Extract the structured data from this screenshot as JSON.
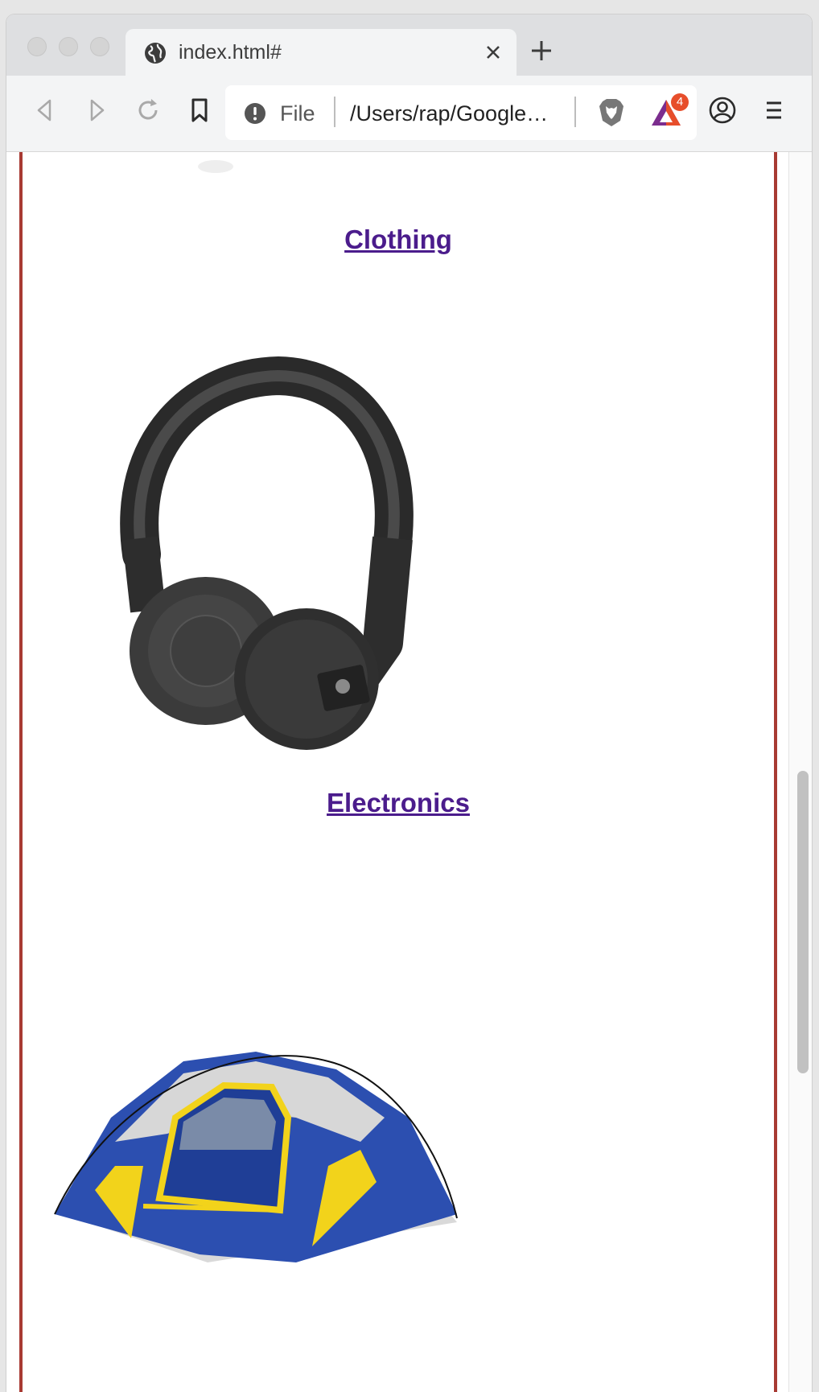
{
  "browser": {
    "tab": {
      "title": "index.html#"
    },
    "url": {
      "scheme": "File",
      "path": "/Users/rap/Google…"
    },
    "rewards_badge": "4"
  },
  "page": {
    "categories": [
      {
        "label": "Clothing",
        "image_icon": "headphones-image"
      },
      {
        "label": "Electronics",
        "image_icon": "tent-image"
      }
    ]
  },
  "colors": {
    "frame_border": "#a83a33",
    "link_visited": "#4b1c8c",
    "tent_blue": "#2c4fb0",
    "tent_yellow": "#f2d31b"
  }
}
